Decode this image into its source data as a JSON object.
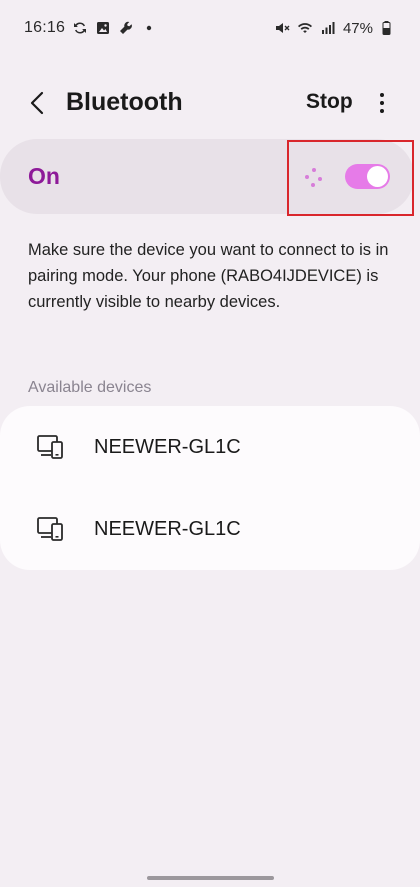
{
  "status_bar": {
    "time": "16:16",
    "battery": "47%",
    "left_icons": [
      "sync-icon",
      "image-icon",
      "wrench-icon",
      "dot-icon"
    ],
    "right_icons": [
      "mute-icon",
      "wifi-icon",
      "signal-icon",
      "battery-icon"
    ]
  },
  "app_bar": {
    "title": "Bluetooth",
    "stop_label": "Stop",
    "back_icon": "back-arrow-icon",
    "more_icon": "more-vert-icon"
  },
  "master_toggle": {
    "label": "On",
    "state": "on",
    "scanning": true,
    "accent_color": "#8e1a99",
    "switch_color": "#e67be8"
  },
  "description": "Make sure the device you want to connect to is in pairing mode. Your phone (RABO4IJDEVICE) is currently visible to nearby devices.",
  "available": {
    "header": "Available devices",
    "devices": [
      {
        "name": "NEEWER-GL1C",
        "icon": "device-icon"
      },
      {
        "name": "NEEWER-GL1C",
        "icon": "device-icon"
      }
    ]
  },
  "colors": {
    "background": "#f3eef3",
    "highlight_border": "#d9262c"
  }
}
